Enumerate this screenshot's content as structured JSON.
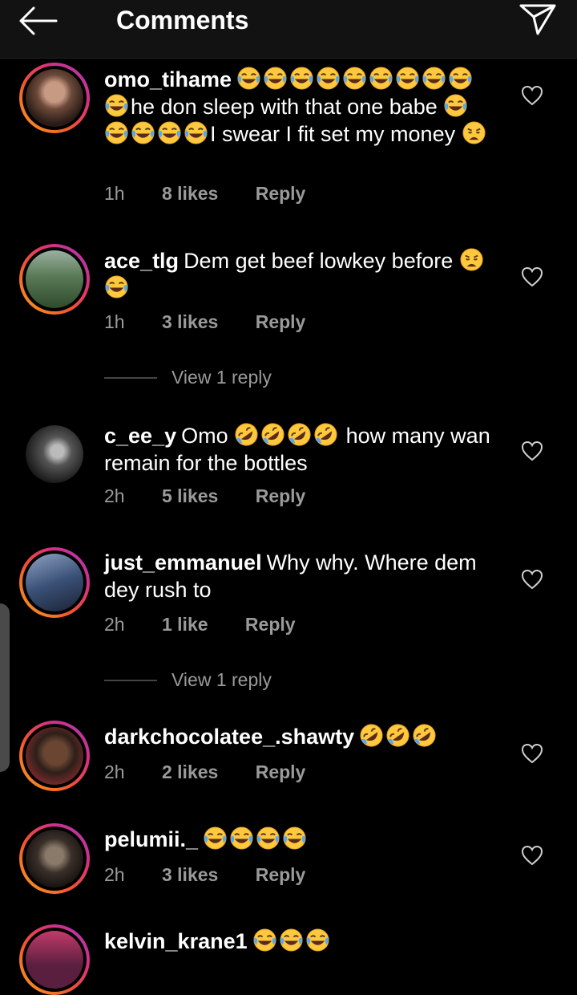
{
  "header": {
    "title": "Comments",
    "back_icon": "arrow-left-icon",
    "send_icon": "paper-plane-icon"
  },
  "emoji_legend": {
    "laugh": "face-with-tears-of-joy",
    "rofl": "rolling-on-floor-laughing",
    "weary": "weary-face"
  },
  "comments": [
    {
      "username": "omo_tihame",
      "text": [
        {
          "e": "laugh"
        },
        {
          "e": "laugh"
        },
        {
          "e": "laugh"
        },
        {
          "e": "laugh"
        },
        {
          "e": "laugh"
        },
        {
          "e": "laugh"
        },
        {
          "e": "laugh"
        },
        {
          "e": "laugh"
        },
        {
          "e": "laugh"
        },
        {
          "e": "laugh"
        },
        {
          "t": "he don sleep with that one babe "
        },
        {
          "e": "laugh"
        },
        {
          "t": " "
        },
        {
          "e": "laugh"
        },
        {
          "e": "laugh"
        },
        {
          "e": "laugh"
        },
        {
          "e": "laugh"
        },
        {
          "t": "I swear I fit set my money "
        },
        {
          "e": "weary"
        }
      ],
      "time": "1h",
      "likes": "8 likes",
      "reply": "Reply"
    },
    {
      "username": "ace_tlg",
      "text": [
        {
          "t": "Dem get beef lowkey before "
        },
        {
          "e": "weary"
        },
        {
          "t": " "
        },
        {
          "e": "laugh"
        }
      ],
      "time": "1h",
      "likes": "3 likes",
      "reply": "Reply",
      "view_replies": "View 1 reply"
    },
    {
      "username": "c_ee_y",
      "text": [
        {
          "t": "Omo "
        },
        {
          "e": "rofl"
        },
        {
          "e": "rofl"
        },
        {
          "e": "rofl"
        },
        {
          "e": "rofl"
        },
        {
          "t": " how many wan remain for the bottles"
        }
      ],
      "time": "2h",
      "likes": "5 likes",
      "reply": "Reply"
    },
    {
      "username": "just_emmanuel",
      "text": [
        {
          "t": "Why why. Where dem dey rush to"
        }
      ],
      "time": "2h",
      "likes": "1 like",
      "reply": "Reply",
      "view_replies": "View 1 reply"
    },
    {
      "username": "darkchocolatee_.shawty",
      "text": [
        {
          "e": "rofl"
        },
        {
          "e": "rofl"
        },
        {
          "e": "rofl"
        }
      ],
      "time": "2h",
      "likes": "2 likes",
      "reply": "Reply"
    },
    {
      "username": "pelumii._",
      "text": [
        {
          "e": "laugh"
        },
        {
          "e": "laugh"
        },
        {
          "e": "laugh"
        },
        {
          "e": "laugh"
        }
      ],
      "time": "2h",
      "likes": "3 likes",
      "reply": "Reply"
    },
    {
      "username": "kelvin_krane1",
      "text": [
        {
          "e": "laugh"
        },
        {
          "e": "laugh"
        },
        {
          "e": "laugh"
        }
      ]
    }
  ]
}
